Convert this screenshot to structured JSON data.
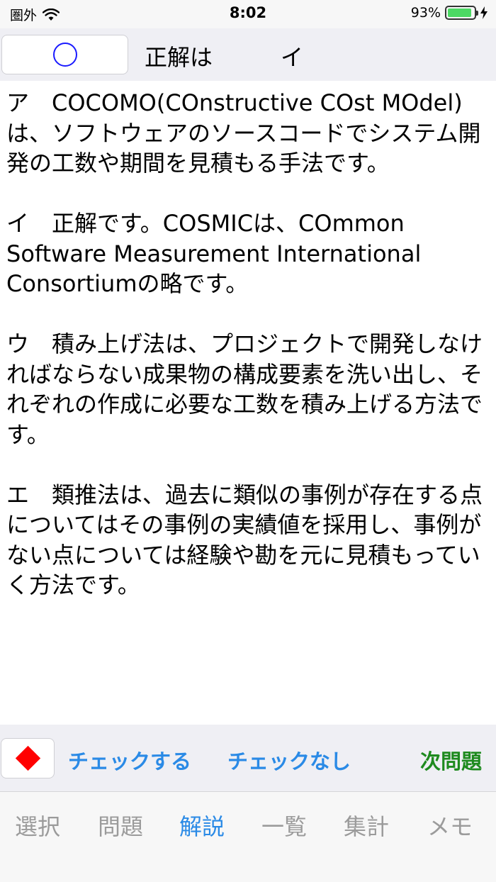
{
  "status": {
    "carrier": "圏外",
    "time": "8:02",
    "battery": "93%",
    "battery_level": 0.93,
    "battery_color": "#4cd964",
    "icons": [
      "wifi-icon",
      "battery-icon",
      "charging-icon"
    ]
  },
  "answer": {
    "mark": "circle-mark",
    "label": "正解は",
    "value": "イ"
  },
  "explanation": {
    "text": "ア　COCOMO(COnstructive COst MOdel)は、ソフトウェアのソースコードでシステム開発の工数や期間を見積もる手法です。\n\nイ　正解です。COSMICは、COmmon Software Measurement International Consortiumの略です。\n\nウ　積み上げ法は、プロジェクトで開発しなければならない成果物の構成要素を洗い出し、それぞれの作成に必要な工数を積み上げる方法です。\n\nエ　類推法は、過去に類似の事例が存在する点についてはその事例の実績値を採用し、事例がない点については経験や勘を元に見積もっていく方法です。"
  },
  "check_bar": {
    "marker": "diamond-marker",
    "marker_color": "#ff0000",
    "check_label": "チェックする",
    "uncheck_label": "チェックなし",
    "next_label": "次問題"
  },
  "tabs": [
    {
      "label": "選択",
      "active": false
    },
    {
      "label": "問題",
      "active": false
    },
    {
      "label": "解説",
      "active": true
    },
    {
      "label": "一覧",
      "active": false
    },
    {
      "label": "集計",
      "active": false
    },
    {
      "label": "メモ",
      "active": false
    }
  ],
  "colors": {
    "accent": "#2a8ae6",
    "next": "#1e8a1e",
    "inactive_tab": "#9b9b9b"
  }
}
